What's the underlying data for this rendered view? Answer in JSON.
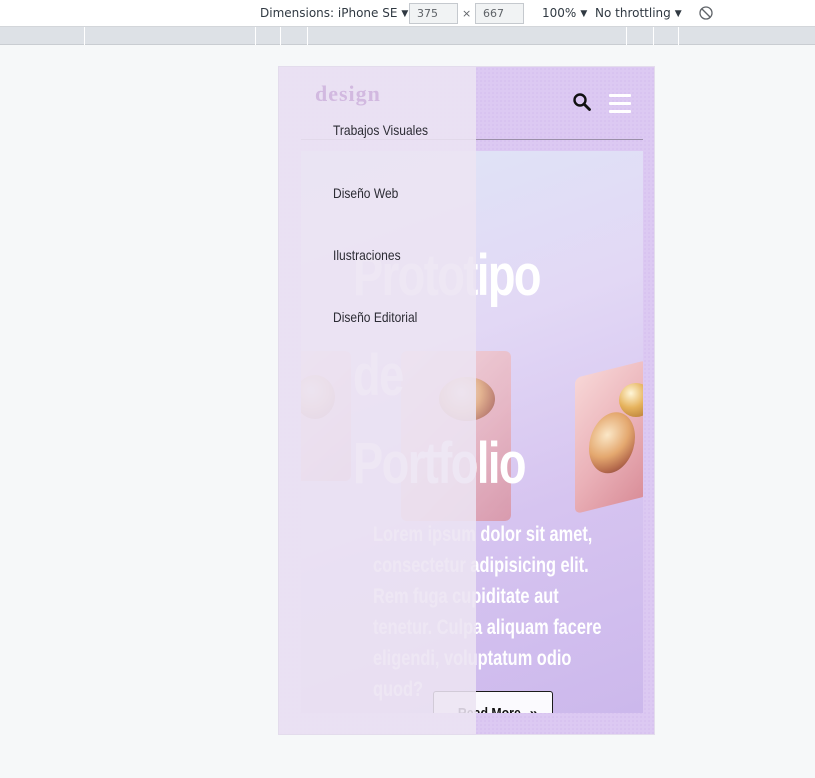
{
  "devtools": {
    "dimensions_label": "Dimensions: iPhone SE",
    "width_value": "375",
    "times": "×",
    "height_value": "667",
    "zoom_label": "100%",
    "throttle_label": "No throttling",
    "caret": "▼"
  },
  "site": {
    "logo_text": "design",
    "nav": [
      {
        "label": "Trabajos Visuales"
      },
      {
        "label": "Diseño Web"
      },
      {
        "label": "Ilustraciones"
      },
      {
        "label": "Diseño Editorial"
      }
    ],
    "hero": {
      "title_line1": "Prototipo",
      "title_line2": "de",
      "title_line3": "Portfolio",
      "text": "Lorem ipsum dolor sit amet, consectetur adipisicing elit. Rem fuga cupiditate aut tenetur. Culpa aliquam facere eligendi, voluptatum odio quod?",
      "button_label": "Read More",
      "button_icon": "»"
    }
  },
  "colors": {
    "sidebar_bg": "#ece4f3",
    "hero_accent": "#dcc9f2",
    "text_white": "#ffffff"
  }
}
